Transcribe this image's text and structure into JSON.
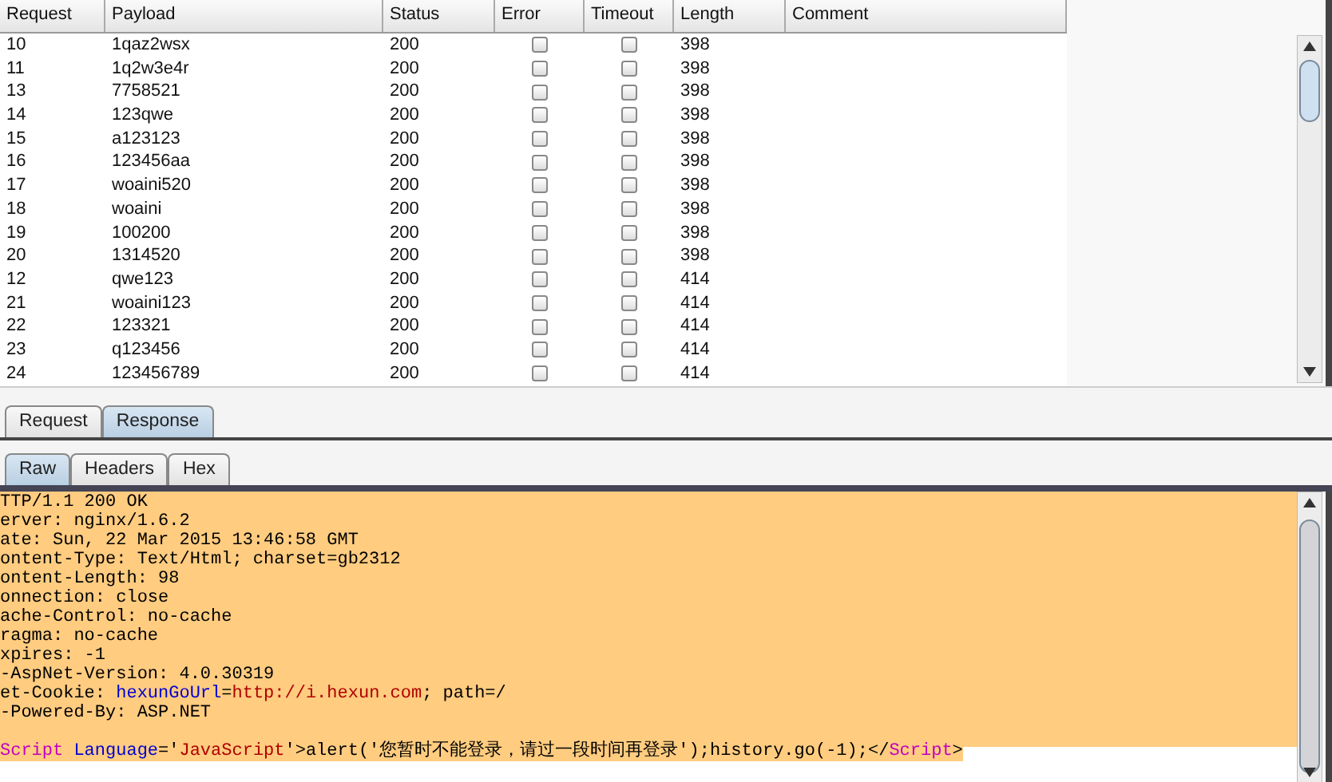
{
  "table": {
    "columns": [
      "Request",
      "Payload",
      "Status",
      "Error",
      "Timeout",
      "Length",
      "Comment"
    ],
    "rows": [
      {
        "request": "10",
        "payload": "1qaz2wsx",
        "status": "200",
        "error": false,
        "timeout": false,
        "length": "398"
      },
      {
        "request": "11",
        "payload": "1q2w3e4r",
        "status": "200",
        "error": false,
        "timeout": false,
        "length": "398"
      },
      {
        "request": "13",
        "payload": "7758521",
        "status": "200",
        "error": false,
        "timeout": false,
        "length": "398"
      },
      {
        "request": "14",
        "payload": "123qwe",
        "status": "200",
        "error": false,
        "timeout": false,
        "length": "398"
      },
      {
        "request": "15",
        "payload": "a123123",
        "status": "200",
        "error": false,
        "timeout": false,
        "length": "398"
      },
      {
        "request": "16",
        "payload": "123456aa",
        "status": "200",
        "error": false,
        "timeout": false,
        "length": "398"
      },
      {
        "request": "17",
        "payload": "woaini520",
        "status": "200",
        "error": false,
        "timeout": false,
        "length": "398"
      },
      {
        "request": "18",
        "payload": "woaini",
        "status": "200",
        "error": false,
        "timeout": false,
        "length": "398"
      },
      {
        "request": "19",
        "payload": "100200",
        "status": "200",
        "error": false,
        "timeout": false,
        "length": "398"
      },
      {
        "request": "20",
        "payload": "1314520",
        "status": "200",
        "error": false,
        "timeout": false,
        "length": "398"
      },
      {
        "request": "12",
        "payload": "qwe123",
        "status": "200",
        "error": false,
        "timeout": false,
        "length": "414"
      },
      {
        "request": "21",
        "payload": "woaini123",
        "status": "200",
        "error": false,
        "timeout": false,
        "length": "414"
      },
      {
        "request": "22",
        "payload": "123321",
        "status": "200",
        "error": false,
        "timeout": false,
        "length": "414"
      },
      {
        "request": "23",
        "payload": "q123456",
        "status": "200",
        "error": false,
        "timeout": false,
        "length": "414"
      },
      {
        "request": "24",
        "payload": "123456789",
        "status": "200",
        "error": false,
        "timeout": false,
        "length": "414"
      }
    ]
  },
  "message_tabs": [
    {
      "label": "Request",
      "selected": false
    },
    {
      "label": "Response",
      "selected": true
    }
  ],
  "view_tabs": [
    {
      "label": "Raw",
      "selected": true
    },
    {
      "label": "Headers",
      "selected": false
    },
    {
      "label": "Hex",
      "selected": false
    }
  ],
  "response_lines": [
    {
      "segments": [
        {
          "kind": "plain",
          "text": "TTP/1.1 200 OK"
        }
      ]
    },
    {
      "segments": [
        {
          "kind": "plain",
          "text": "erver: nginx/1.6.2"
        }
      ]
    },
    {
      "segments": [
        {
          "kind": "plain",
          "text": "ate: Sun, 22 Mar 2015 13:46:58 GMT"
        }
      ]
    },
    {
      "segments": [
        {
          "kind": "plain",
          "text": "ontent-Type: Text/Html; charset=gb2312"
        }
      ]
    },
    {
      "segments": [
        {
          "kind": "plain",
          "text": "ontent-Length: 98"
        }
      ]
    },
    {
      "segments": [
        {
          "kind": "plain",
          "text": "onnection: close"
        }
      ]
    },
    {
      "segments": [
        {
          "kind": "plain",
          "text": "ache-Control: no-cache"
        }
      ]
    },
    {
      "segments": [
        {
          "kind": "plain",
          "text": "ragma: no-cache"
        }
      ]
    },
    {
      "segments": [
        {
          "kind": "plain",
          "text": "xpires: -1"
        }
      ]
    },
    {
      "segments": [
        {
          "kind": "plain",
          "text": "-AspNet-Version: 4.0.30319"
        }
      ]
    },
    {
      "segments": [
        {
          "kind": "plain",
          "text": "et-Cookie: "
        },
        {
          "kind": "name",
          "text": "hexunGoUrl"
        },
        {
          "kind": "plain",
          "text": "="
        },
        {
          "kind": "value",
          "text": "http://i.hexun.com"
        },
        {
          "kind": "plain",
          "text": "; path=/"
        }
      ]
    },
    {
      "segments": [
        {
          "kind": "plain",
          "text": "-Powered-By: ASP.NET"
        }
      ]
    },
    {
      "gap_before": true,
      "segments": [
        {
          "kind": "tag",
          "text": "Script"
        },
        {
          "kind": "name",
          "text": " Language"
        },
        {
          "kind": "plain",
          "text": "='"
        },
        {
          "kind": "value",
          "text": "JavaScript"
        },
        {
          "kind": "plain",
          "text": "'>alert('您暂时不能登录，请过一段时间再登录');history.go(-1);</"
        },
        {
          "kind": "tag",
          "text": "Script"
        },
        {
          "kind": "plain",
          "text": ">"
        }
      ]
    }
  ]
}
